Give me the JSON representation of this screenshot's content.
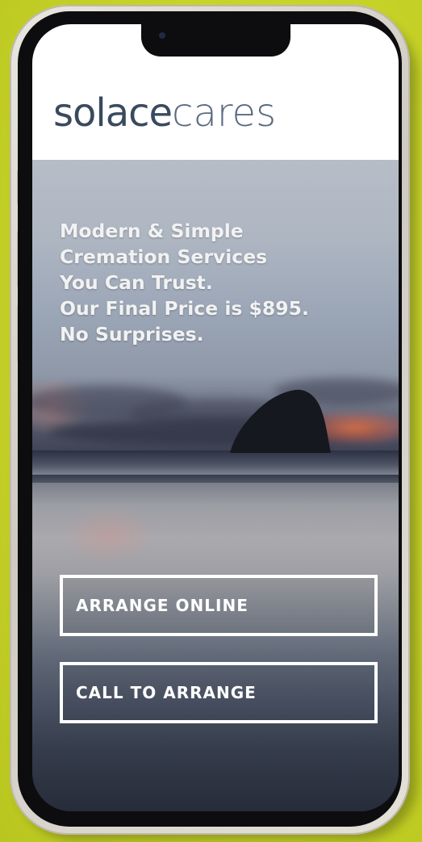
{
  "brand": {
    "logo_primary": "solace",
    "logo_secondary": "cares"
  },
  "hero": {
    "headline_lines": [
      "Modern & Simple",
      "Cremation Services",
      "You Can Trust.",
      "Our Final Price is $895.",
      "No Surprises."
    ]
  },
  "actions": {
    "arrange_online_label": "ARRANGE ONLINE",
    "call_to_arrange_label": "CALL TO ARRANGE"
  },
  "colors": {
    "background": "#c9d42a",
    "logo_dark": "#3a4a5e",
    "logo_light": "#5a6b80",
    "button_border": "#ffffff"
  }
}
